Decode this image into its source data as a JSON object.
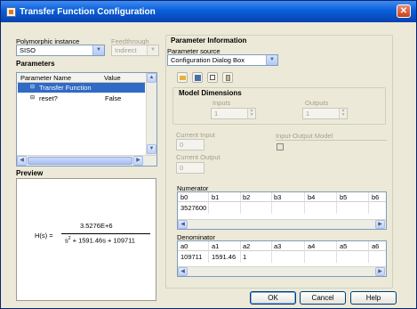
{
  "window": {
    "title": "Transfer Function Configuration"
  },
  "left": {
    "polymorphic_label": "Polymorphic instance",
    "polymorphic_value": "SISO",
    "feedthrough_label": "Feedthrough",
    "feedthrough_value": "Indirect",
    "parameters_header": "Parameters",
    "col_name": "Parameter Name",
    "col_value": "Value",
    "rows": [
      {
        "name": "Transfer Function",
        "value": "",
        "selected": true
      },
      {
        "name": "reset?",
        "value": "False",
        "selected": false
      }
    ],
    "preview_header": "Preview",
    "formula": {
      "lhs": "H(s) =",
      "numerator": "3.5276E+6",
      "denominator_pre": "s",
      "denominator_exp": "2",
      "denominator_post": " + 1591.46s + 109711"
    }
  },
  "right": {
    "param_info_header": "Parameter Information",
    "source_label": "Parameter source",
    "source_value": "Configuration Dialog Box",
    "model_dimensions_header": "Model Dimensions",
    "inputs_label": "Inputs",
    "inputs_value": "1",
    "outputs_label": "Outputs",
    "outputs_value": "1",
    "current_input_label": "Current Input",
    "current_input_value": "0",
    "current_output_label": "Current Output",
    "current_output_value": "0",
    "io_model_label": "Input-Output Model",
    "numerator_label": "Numerator",
    "numerator_cols": [
      "b0",
      "b1",
      "b2",
      "b3",
      "b4",
      "b5",
      "b6"
    ],
    "numerator_vals": [
      "3527600",
      "",
      "",
      "",
      "",
      "",
      ""
    ],
    "denominator_label": "Denominator",
    "denominator_cols": [
      "a0",
      "a1",
      "a2",
      "a3",
      "a4",
      "a5",
      "a6"
    ],
    "denominator_vals": [
      "109711",
      "1591.46",
      "1",
      "",
      "",
      "",
      ""
    ]
  },
  "buttons": {
    "ok": "OK",
    "cancel": "Cancel",
    "help": "Help"
  },
  "colors": {
    "titlebar": "#0a5fd8",
    "selection": "#316ac5",
    "dialog_bg": "#ece9d8"
  }
}
